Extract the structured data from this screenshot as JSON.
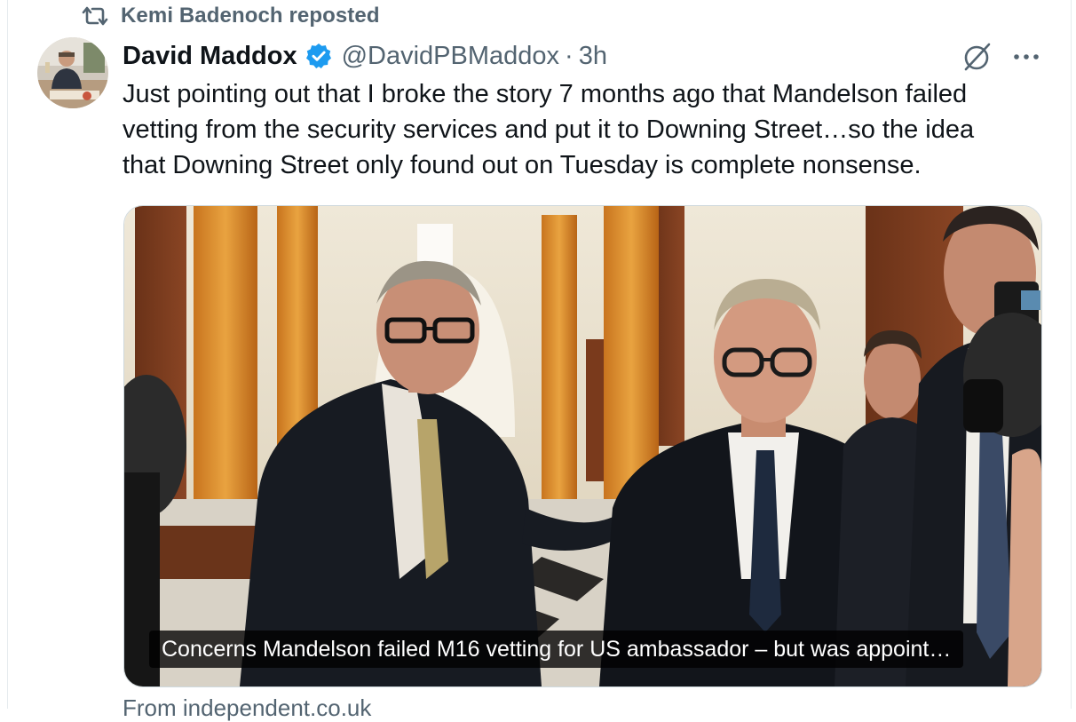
{
  "repost": {
    "icon": "repost-icon",
    "text": "Kemi Badenoch reposted"
  },
  "author": {
    "name": "David Maddox",
    "verified_icon": "verified-badge-icon",
    "handle": "@DavidPBMaddox",
    "separator": "·",
    "time": "3h"
  },
  "actions": {
    "grok_icon": "grok-icon",
    "more_icon": "more-icon"
  },
  "tweet": {
    "lines": [
      "Just pointing out that I broke the story 7 months ago that Mandelson failed",
      "vetting from the security services and put it to Downing Street…so the idea",
      "that Downing Street only found out on Tuesday is complete nonsense."
    ]
  },
  "card": {
    "caption": "Concerns Mandelson failed M16 vetting for US ambassador – but was appoint…",
    "source": "From independent.co.uk"
  },
  "colors": {
    "verified": "#1d9bf0",
    "secondary_text": "#536471",
    "primary_text": "#0f1419",
    "border": "#cfd9de"
  }
}
